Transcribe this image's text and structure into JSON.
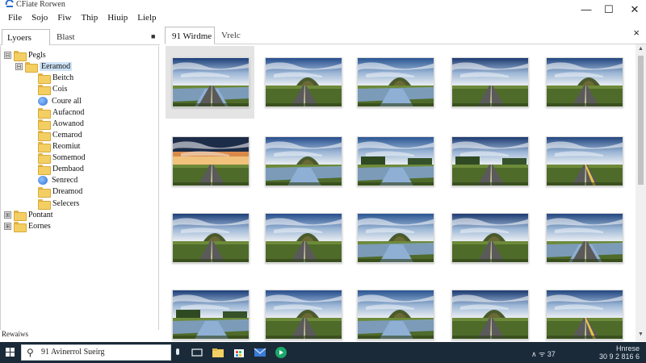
{
  "window": {
    "title": "CFiate Rorwen",
    "controls": {
      "minimize": "—",
      "maximize": "☐",
      "close": "✕"
    }
  },
  "menu": [
    "File",
    "Sojo",
    "Fiw",
    "Thip",
    "Hiuip",
    "Lielp"
  ],
  "left_panel": {
    "tabs": [
      "Lyoers",
      "Blast"
    ],
    "pin": "■",
    "tree": [
      {
        "label": "Pegls",
        "expander": "⊟",
        "level": 0,
        "icon": "folder"
      },
      {
        "label": "Eeramod",
        "expander": "⊟",
        "level": 1,
        "icon": "folder",
        "selected": true
      },
      {
        "label": "Beitch",
        "level": 2,
        "icon": "folder"
      },
      {
        "label": "Cois",
        "level": 2,
        "icon": "folder"
      },
      {
        "label": "Coure all",
        "level": 2,
        "icon": "blue-disc"
      },
      {
        "label": "Aufacnod",
        "level": 2,
        "icon": "folder"
      },
      {
        "label": "Aowanod",
        "level": 2,
        "icon": "folder"
      },
      {
        "label": "Cemarod",
        "level": 2,
        "icon": "folder"
      },
      {
        "label": "Reomiut",
        "level": 2,
        "icon": "folder"
      },
      {
        "label": "Somemod",
        "level": 2,
        "icon": "folder"
      },
      {
        "label": "Dembaod",
        "level": 2,
        "icon": "folder"
      },
      {
        "label": "Senrecd",
        "level": 2,
        "icon": "blue-disc"
      },
      {
        "label": "Dreamod",
        "level": 2,
        "icon": "folder"
      },
      {
        "label": "Selecers",
        "level": 2,
        "icon": "folder"
      },
      {
        "label": "Pontant",
        "expander": "⊞",
        "level": 0,
        "icon": "folder"
      },
      {
        "label": "Eornes",
        "expander": "⊞",
        "level": 0,
        "icon": "folder"
      }
    ]
  },
  "status_left": "Rewaiws",
  "right_panel": {
    "tabs": [
      "91 Wirdme",
      "Vrelc"
    ],
    "close": "×",
    "thumbnails": [
      {
        "scene": "water-cloud-road"
      },
      {
        "scene": "road-hill"
      },
      {
        "scene": "river-hill"
      },
      {
        "scene": "road-cloud"
      },
      {
        "scene": "road-hill"
      },
      {
        "scene": "sunset-rails"
      },
      {
        "scene": "river-hill"
      },
      {
        "scene": "river-trees"
      },
      {
        "scene": "road-trees"
      },
      {
        "scene": "road-lines"
      },
      {
        "scene": "road-hill"
      },
      {
        "scene": "road-hill"
      },
      {
        "scene": "river-hill"
      },
      {
        "scene": "road-hill"
      },
      {
        "scene": "water-cloud-road"
      },
      {
        "scene": "river-trees"
      },
      {
        "scene": "road-hill"
      },
      {
        "scene": "river-hill"
      },
      {
        "scene": "road-hill"
      },
      {
        "scene": "road-lines"
      }
    ]
  },
  "taskbar": {
    "search_text": "91 Avinerrol Sueirg",
    "tray_line1": "Hnrese",
    "tray_line2": "30 9 2 816 6",
    "tray_icons": "∧ ᯤ 37"
  },
  "colors": {
    "taskbar_bg": "#1b2a38",
    "folder_yellow": "#f3cf63",
    "selection_blue": "#cfe3f7"
  }
}
